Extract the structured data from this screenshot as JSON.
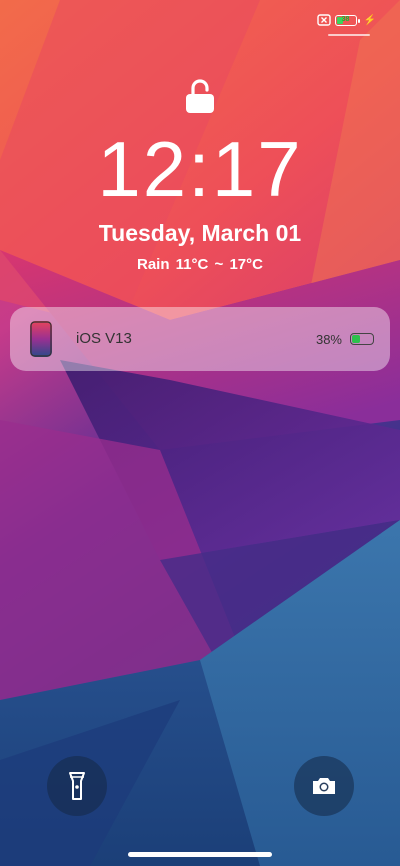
{
  "status_bar": {
    "battery_percent": 38,
    "battery_label": "38",
    "charging": true,
    "sim_icon": "no-sim-icon"
  },
  "lock_icon": "unlocked-padlock-icon",
  "time": "12:17",
  "date": "Tuesday, March 01",
  "weather": "Rain  11°C ~ 17°C",
  "notification": {
    "app_icon": "phone-thumbnail-icon",
    "title": "iOS V13",
    "battery_label": "38%",
    "battery_percent": 38,
    "battery_color": "#2ec04c"
  },
  "controls": {
    "left": "flashlight-icon",
    "right": "camera-icon"
  }
}
